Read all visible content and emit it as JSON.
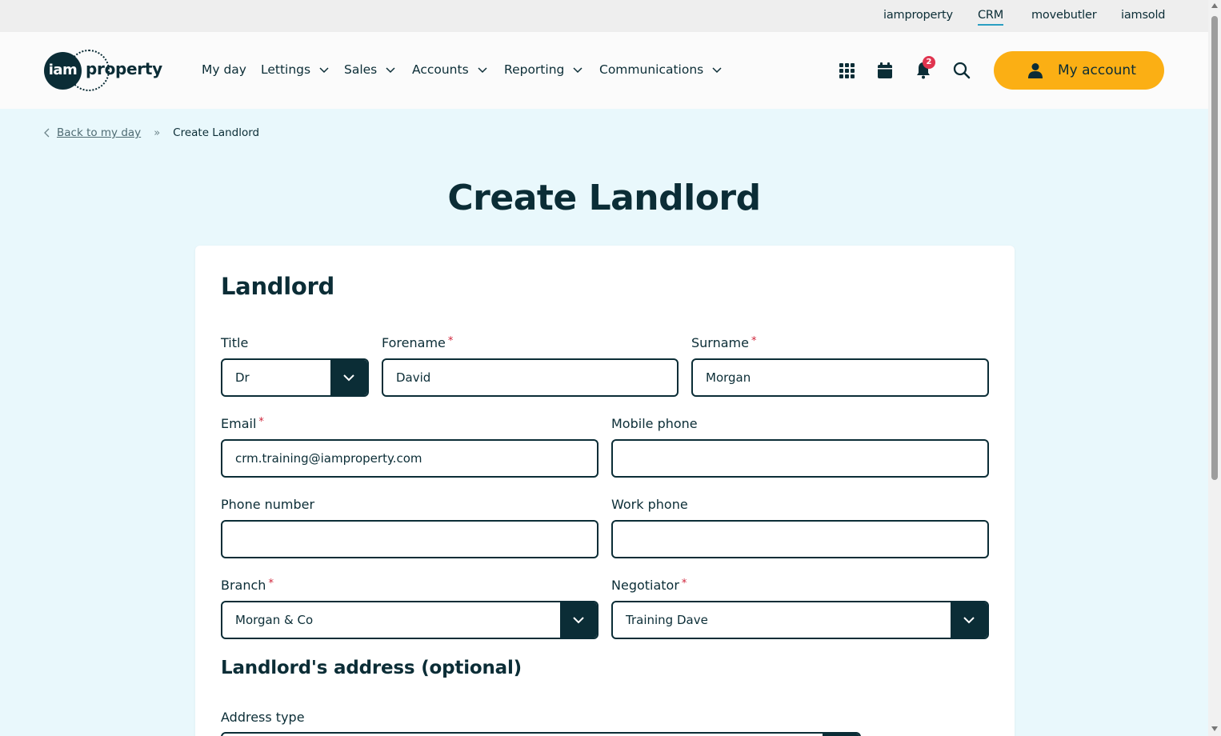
{
  "utility_nav": {
    "items": [
      {
        "label": "iamproperty",
        "active": false
      },
      {
        "label": "CRM",
        "active": true
      },
      {
        "label": "movebutler",
        "active": false
      },
      {
        "label": "iamsold",
        "active": false
      }
    ]
  },
  "logo": {
    "circle_text": "iam",
    "text": "property"
  },
  "main_nav": {
    "items": [
      {
        "label": "My day",
        "has_dropdown": false
      },
      {
        "label": "Lettings",
        "has_dropdown": true
      },
      {
        "label": "Sales",
        "has_dropdown": true
      },
      {
        "label": "Accounts",
        "has_dropdown": true
      },
      {
        "label": "Reporting",
        "has_dropdown": true
      },
      {
        "label": "Communications",
        "has_dropdown": true
      }
    ]
  },
  "header_icons": {
    "apps": "grid-icon",
    "calendar": "calendar-icon",
    "notifications": "bell-icon",
    "notification_count": "2",
    "search": "search-icon"
  },
  "account_button": {
    "label": "My account",
    "icon": "user-icon"
  },
  "breadcrumb": {
    "back_label": "Back to my day",
    "current": "Create Landlord"
  },
  "page": {
    "title": "Create Landlord"
  },
  "form": {
    "section_title": "Landlord",
    "title_field": {
      "label": "Title",
      "value": "Dr"
    },
    "forename": {
      "label": "Forename",
      "value": "David",
      "required": true
    },
    "surname": {
      "label": "Surname",
      "value": "Morgan",
      "required": true
    },
    "email": {
      "label": "Email",
      "value": "crm.training@iamproperty.com",
      "required": true
    },
    "mobile_phone": {
      "label": "Mobile phone",
      "value": ""
    },
    "phone_number": {
      "label": "Phone number",
      "value": ""
    },
    "work_phone": {
      "label": "Work phone",
      "value": ""
    },
    "branch": {
      "label": "Branch",
      "value": "Morgan & Co",
      "required": true
    },
    "negotiator": {
      "label": "Negotiator",
      "value": "Training Dave",
      "required": true
    },
    "address_section_title": "Landlord's address (optional)",
    "address_type": {
      "label": "Address type"
    }
  },
  "colors": {
    "primary": "#0b2d36",
    "accent": "#fbaf14",
    "page_bg": "#e9f8fc",
    "required": "#d0253b",
    "badge": "#e0344f",
    "active_underline": "#2a9fc2"
  }
}
